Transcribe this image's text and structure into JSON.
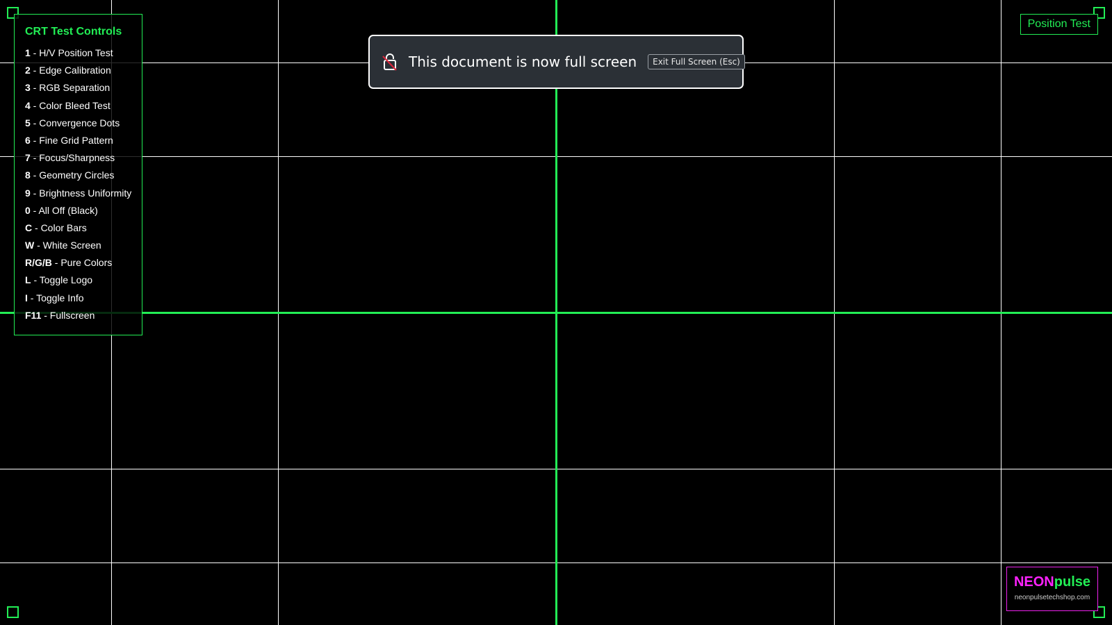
{
  "controls_panel": {
    "title": "CRT Test Controls",
    "items": [
      {
        "key": "1",
        "label": " - H/V Position Test"
      },
      {
        "key": "2",
        "label": " - Edge Calibration"
      },
      {
        "key": "3",
        "label": " - RGB Separation"
      },
      {
        "key": "4",
        "label": " - Color Bleed Test"
      },
      {
        "key": "5",
        "label": " - Convergence Dots"
      },
      {
        "key": "6",
        "label": " - Fine Grid Pattern"
      },
      {
        "key": "7",
        "label": " - Focus/Sharpness"
      },
      {
        "key": "8",
        "label": " - Geometry Circles"
      },
      {
        "key": "9",
        "label": " - Brightness Uniformity"
      },
      {
        "key": "0",
        "label": " - All Off (Black)"
      },
      {
        "key": "C",
        "label": " - Color Bars"
      },
      {
        "key": "W",
        "label": " - White Screen"
      },
      {
        "key": "R/G/B",
        "label": " - Pure Colors"
      },
      {
        "key": "L",
        "label": " - Toggle Logo"
      },
      {
        "key": "I",
        "label": " - Toggle Info"
      },
      {
        "key": "F11",
        "label": " - Fullscreen"
      }
    ]
  },
  "position_label": "Position Test",
  "fullscreen_notice": {
    "message": "This document is now full screen",
    "exit_label": "Exit Full Screen (Esc)"
  },
  "logo": {
    "neon": "NEON",
    "pulse": "pulse",
    "url": "neonpulsetechshop.com"
  },
  "colors": {
    "accent_green": "#22ee55",
    "grid_white": "#ffffff",
    "logo_magenta": "#ff22ff",
    "background": "#000000"
  }
}
